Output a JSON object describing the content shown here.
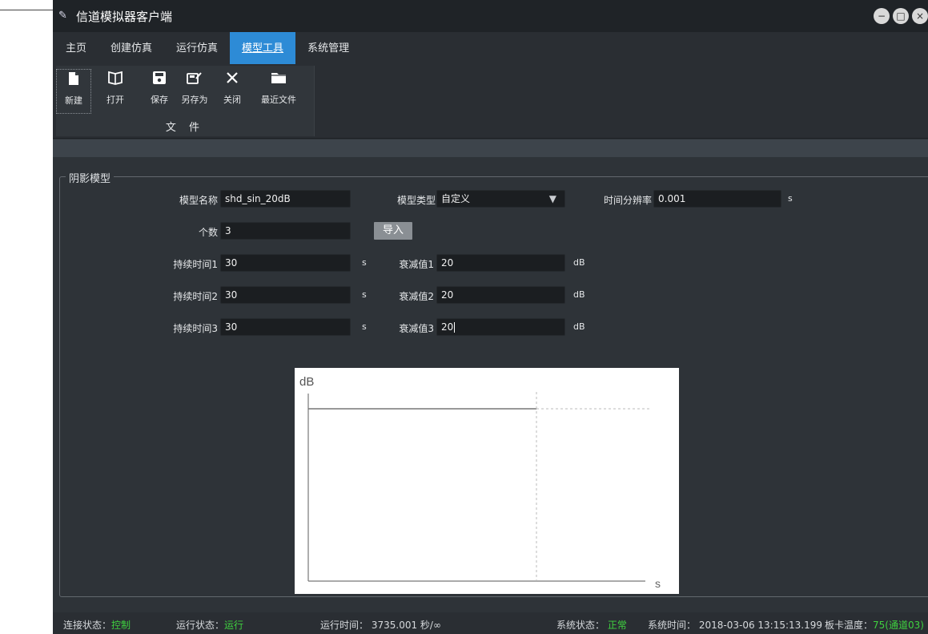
{
  "window": {
    "title": "信道模拟器客户端",
    "controls": {
      "minimize": "−",
      "maximize": "□",
      "close": "×"
    }
  },
  "menu": [
    {
      "label": "主页",
      "active": false
    },
    {
      "label": "创建仿真",
      "active": false
    },
    {
      "label": "运行仿真",
      "active": false
    },
    {
      "label": "模型工具",
      "active": true
    },
    {
      "label": "系统管理",
      "active": false
    }
  ],
  "ribbon": {
    "group_label": "文 件",
    "tools": [
      {
        "label": "新建",
        "icon": "new-file-icon"
      },
      {
        "label": "打开",
        "icon": "open-book-icon"
      },
      {
        "label": "保存",
        "icon": "save-disk-icon"
      },
      {
        "label": "另存为",
        "icon": "save-as-icon"
      },
      {
        "label": "关闭",
        "icon": "close-x-icon"
      },
      {
        "label": "最近文件",
        "icon": "folder-icon"
      }
    ]
  },
  "panel": {
    "legend": "阴影模型",
    "model_name_label": "模型名称",
    "model_name": "shd_sin_20dB",
    "model_type_label": "模型类型",
    "model_type": "自定义",
    "time_res_label": "时间分辨率",
    "time_res": "0.001",
    "time_res_unit": "s",
    "count_label": "个数",
    "count": "3",
    "import_button": "导入",
    "rows": [
      {
        "duration_label": "持续时间1",
        "duration": "30",
        "duration_unit": "s",
        "atten_label": "衰减值1",
        "atten": "20",
        "atten_unit": "dB"
      },
      {
        "duration_label": "持续时间2",
        "duration": "30",
        "duration_unit": "s",
        "atten_label": "衰减值2",
        "atten": "20",
        "atten_unit": "dB"
      },
      {
        "duration_label": "持续时间3",
        "duration": "30",
        "duration_unit": "s",
        "atten_label": "衰减值3",
        "atten": "20",
        "atten_unit": "dB"
      }
    ]
  },
  "chart": {
    "y_label": "dB",
    "x_label": "s"
  },
  "status": {
    "conn_label": "连接状态：",
    "conn_value": "控制",
    "run_label": "运行状态：",
    "run_value": "运行",
    "runtime_label": "运行时间：",
    "runtime_value": "3735.001 秒/∞",
    "sys_label": "系统状态：",
    "sys_value": "正常",
    "systime_label": "系统时间：",
    "systime_value": "2018-03-06 13:15:13.199",
    "temp_label": "板卡温度：",
    "temp_value": "75(通道03)"
  },
  "colors": {
    "accent": "#2d8bd6",
    "status_ok": "#3fd23f",
    "background": "#2e3338"
  }
}
